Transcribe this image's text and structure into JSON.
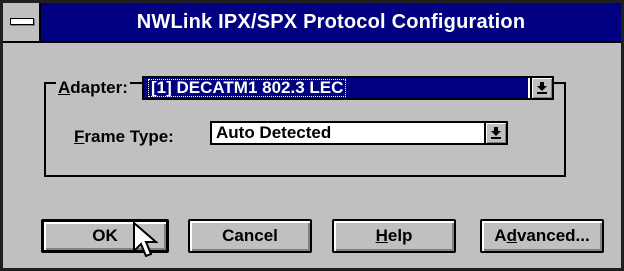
{
  "window": {
    "title": "NWLink IPX/SPX Protocol Configuration"
  },
  "adapter": {
    "label_accel": "A",
    "label_rest": "dapter:",
    "value": "[1] DECATM1 802.3 LEC"
  },
  "frame_type": {
    "label_accel": "F",
    "label_rest": "rame Type:",
    "value": "Auto Detected"
  },
  "buttons": {
    "ok": "OK",
    "cancel": "Cancel",
    "help_accel": "H",
    "help_rest": "elp",
    "advanced_pre": "A",
    "advanced_accel": "d",
    "advanced_rest": "vanced..."
  },
  "colors": {
    "title_bar": "#000080",
    "face": "#c0c0c0",
    "selection": "#000080"
  },
  "icons": {
    "system_menu": "system-menu-icon",
    "dropdown": "dropdown-arrow-icon",
    "cursor": "mouse-pointer-icon"
  }
}
